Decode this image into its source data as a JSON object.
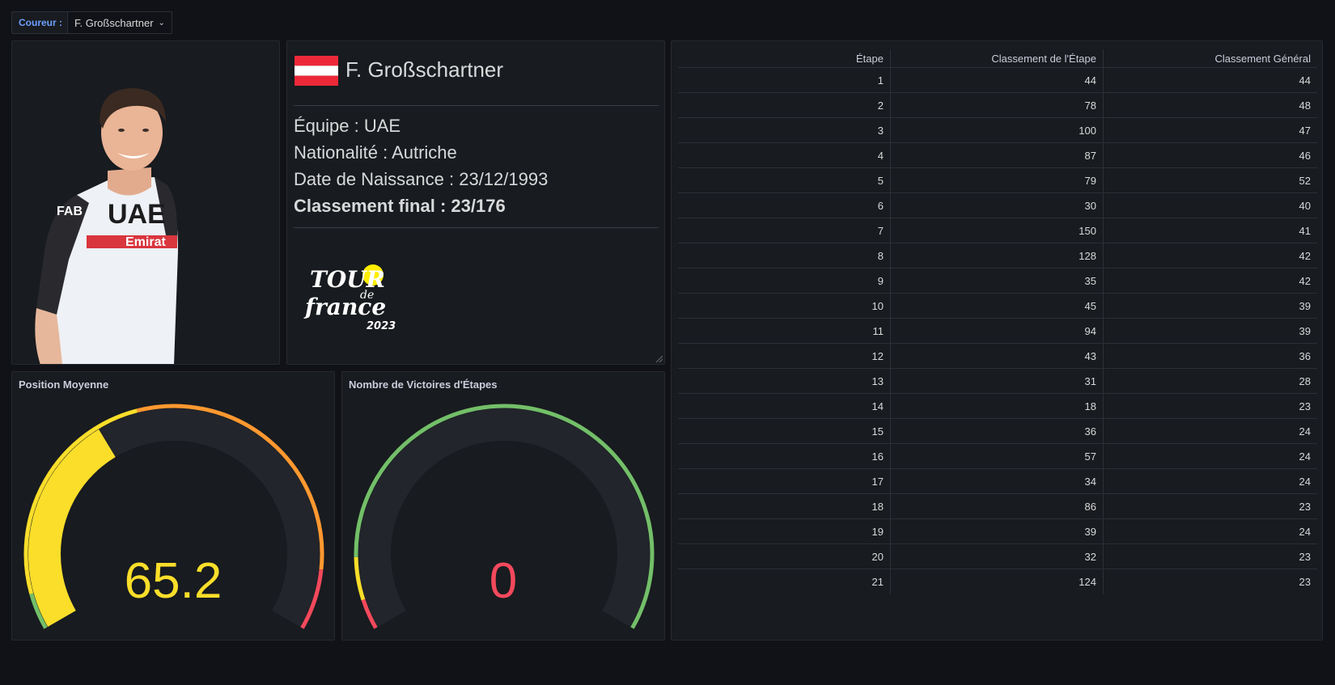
{
  "variable": {
    "label": "Coureur :",
    "value": "F. Großschartner"
  },
  "rider": {
    "name": "F. Großschartner",
    "team": "Équipe : UAE",
    "nationality": "Nationalité : Autriche",
    "birthdate": "Date de Naissance : 23/12/1993",
    "final_rank": "Classement final : 23/176",
    "logo_text": [
      "TOUR",
      "de",
      "france",
      "2023"
    ]
  },
  "gauges": [
    {
      "title": "Position Moyenne",
      "value": "65.2",
      "value_num": 65.2,
      "min": 0,
      "max": 176,
      "color": "#fade2a"
    },
    {
      "title": "Nombre de Victoires d'Étapes",
      "value": "0",
      "value_num": 0,
      "min": 0,
      "max": 21,
      "color": "#f2495c"
    }
  ],
  "table": {
    "headers": [
      "Étape",
      "Classement de l'Étape",
      "Classement Général"
    ],
    "rows": [
      [
        "1",
        "44",
        "44"
      ],
      [
        "2",
        "78",
        "48"
      ],
      [
        "3",
        "100",
        "47"
      ],
      [
        "4",
        "87",
        "46"
      ],
      [
        "5",
        "79",
        "52"
      ],
      [
        "6",
        "30",
        "40"
      ],
      [
        "7",
        "150",
        "41"
      ],
      [
        "8",
        "128",
        "42"
      ],
      [
        "9",
        "35",
        "42"
      ],
      [
        "10",
        "45",
        "39"
      ],
      [
        "11",
        "94",
        "39"
      ],
      [
        "12",
        "43",
        "36"
      ],
      [
        "13",
        "31",
        "28"
      ],
      [
        "14",
        "18",
        "23"
      ],
      [
        "15",
        "36",
        "24"
      ],
      [
        "16",
        "57",
        "24"
      ],
      [
        "17",
        "34",
        "24"
      ],
      [
        "18",
        "86",
        "23"
      ],
      [
        "19",
        "39",
        "24"
      ],
      [
        "20",
        "32",
        "23"
      ],
      [
        "21",
        "124",
        "23"
      ]
    ]
  },
  "colors": {
    "green": "#73bf69",
    "yellow": "#fade2a",
    "orange": "#ff9830",
    "red": "#f2495c"
  }
}
